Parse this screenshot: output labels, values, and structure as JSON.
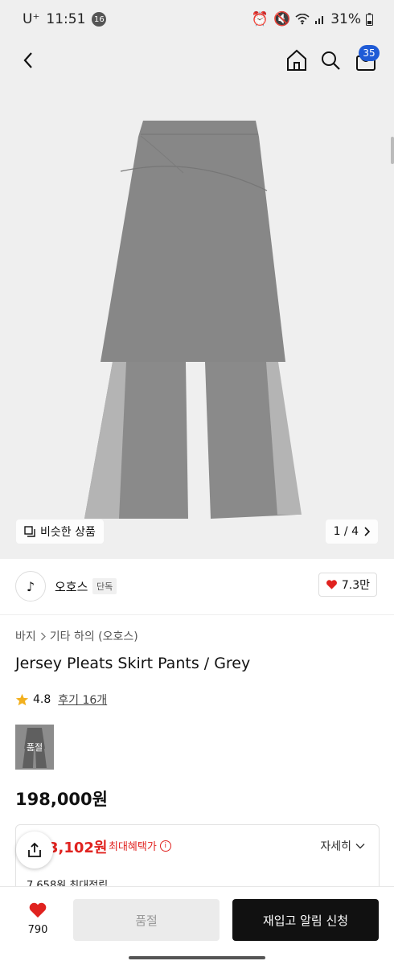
{
  "status_bar": {
    "carrier": "U⁺",
    "time": "11:51",
    "badge": "16",
    "battery": "31%"
  },
  "header": {
    "cart_count": "35"
  },
  "gallery": {
    "similar_label": "비슷한 상품",
    "pager": "1 / 4"
  },
  "brand": {
    "logo_glyph": "♪",
    "name": "오호스",
    "tag": "단독",
    "likes": "7.3만"
  },
  "breadcrumb": [
    "바지",
    "기타 하의 (오호스)"
  ],
  "product": {
    "title": "Jersey Pleats Skirt Pants / Grey",
    "rating": "4.8",
    "reviews": "후기 16개",
    "thumb_label": "품절",
    "price": "198,000원"
  },
  "benefit": {
    "price": "3,102원",
    "label": "최대혜택가",
    "info": "i",
    "detail": "자세히",
    "points": "7,658원 최대적립"
  },
  "bottom": {
    "wish_count": "790",
    "soldout_label": "품절",
    "restock_label": "재입고 알림 신청"
  },
  "colors": {
    "accent_red": "#e0221f",
    "cart_badge": "#1f5bd6",
    "cta_black": "#111111"
  }
}
